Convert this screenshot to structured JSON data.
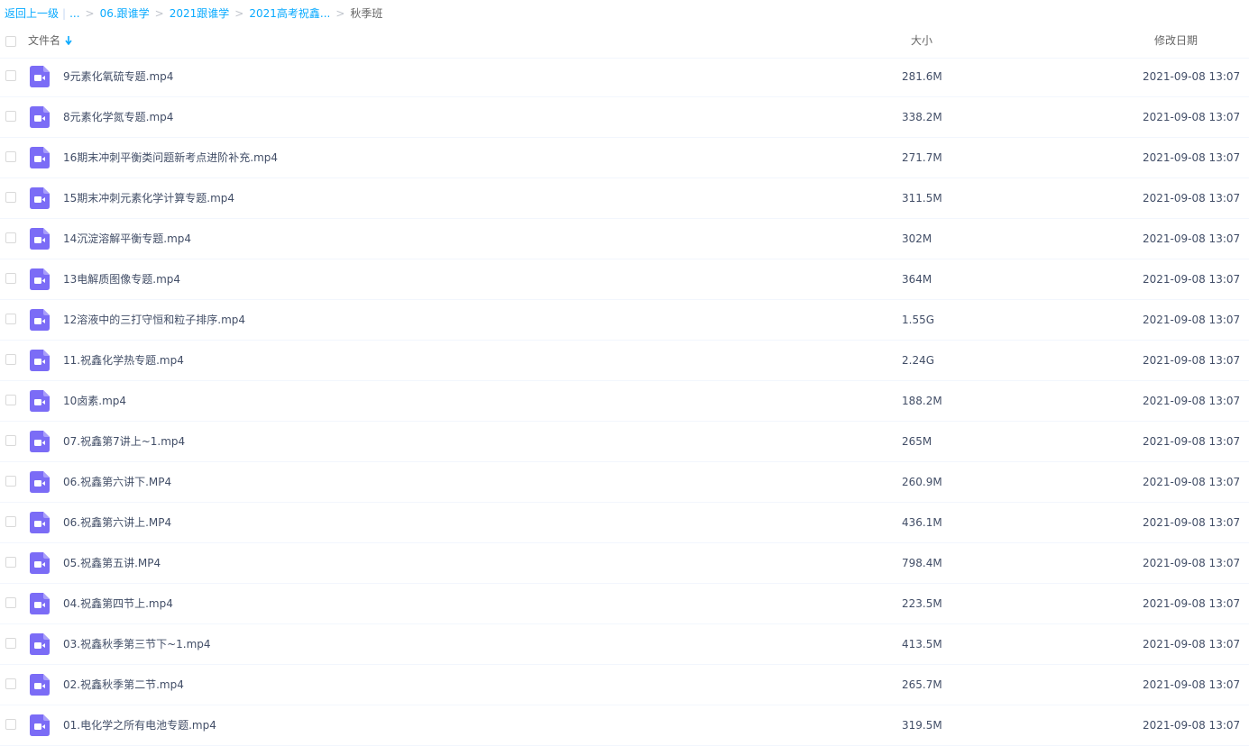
{
  "breadcrumb": {
    "back_label": "返回上一级",
    "ellipsis": "...",
    "items": [
      "06.跟谁学",
      "2021跟谁学",
      "2021高考祝鑫..."
    ],
    "current": "秋季班",
    "separator": ">"
  },
  "columns": {
    "name": "文件名",
    "size": "大小",
    "date": "修改日期"
  },
  "icons": {
    "sort": "arrow-down-icon",
    "file": "video-file-icon"
  },
  "colors": {
    "link": "#09aaff",
    "video_icon": "#7b6cf6"
  },
  "files": [
    {
      "name": "9元素化氧硫专题.mp4",
      "size": "281.6M",
      "date": "2021-09-08 13:07"
    },
    {
      "name": "8元素化学氮专题.mp4",
      "size": "338.2M",
      "date": "2021-09-08 13:07"
    },
    {
      "name": "16期末冲刺平衡类问题新考点进阶补充.mp4",
      "size": "271.7M",
      "date": "2021-09-08 13:07"
    },
    {
      "name": "15期末冲刺元素化学计算专题.mp4",
      "size": "311.5M",
      "date": "2021-09-08 13:07"
    },
    {
      "name": "14沉淀溶解平衡专题.mp4",
      "size": "302M",
      "date": "2021-09-08 13:07"
    },
    {
      "name": "13电解质图像专题.mp4",
      "size": "364M",
      "date": "2021-09-08 13:07"
    },
    {
      "name": "12溶液中的三打守恒和粒子排序.mp4",
      "size": "1.55G",
      "date": "2021-09-08 13:07"
    },
    {
      "name": "11.祝鑫化学热专题.mp4",
      "size": "2.24G",
      "date": "2021-09-08 13:07"
    },
    {
      "name": "10卤素.mp4",
      "size": "188.2M",
      "date": "2021-09-08 13:07"
    },
    {
      "name": "07.祝鑫第7讲上~1.mp4",
      "size": "265M",
      "date": "2021-09-08 13:07"
    },
    {
      "name": "06.祝鑫第六讲下.MP4",
      "size": "260.9M",
      "date": "2021-09-08 13:07"
    },
    {
      "name": "06.祝鑫第六讲上.MP4",
      "size": "436.1M",
      "date": "2021-09-08 13:07"
    },
    {
      "name": "05.祝鑫第五讲.MP4",
      "size": "798.4M",
      "date": "2021-09-08 13:07"
    },
    {
      "name": "04.祝鑫第四节上.mp4",
      "size": "223.5M",
      "date": "2021-09-08 13:07"
    },
    {
      "name": "03.祝鑫秋季第三节下~1.mp4",
      "size": "413.5M",
      "date": "2021-09-08 13:07"
    },
    {
      "name": "02.祝鑫秋季第二节.mp4",
      "size": "265.7M",
      "date": "2021-09-08 13:07"
    },
    {
      "name": "01.电化学之所有电池专题.mp4",
      "size": "319.5M",
      "date": "2021-09-08 13:07"
    }
  ]
}
